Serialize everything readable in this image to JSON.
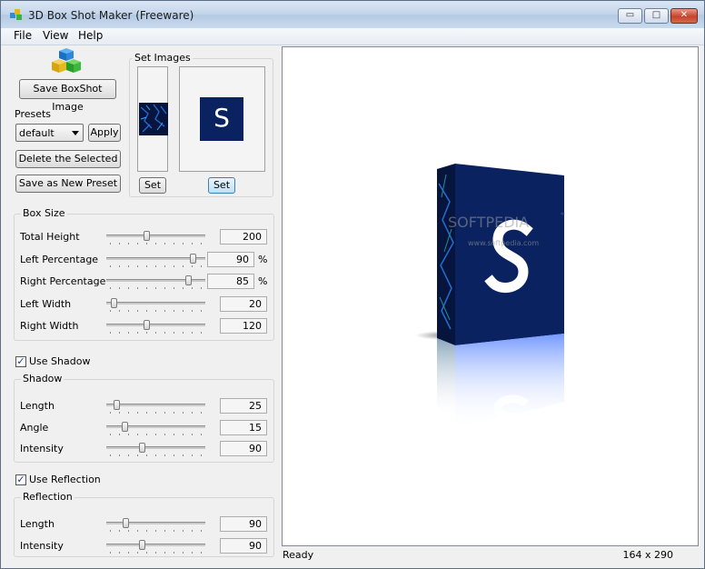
{
  "window": {
    "title": "3D Box Shot Maker (Freeware)",
    "min": "▭",
    "max": "□",
    "close": "✕"
  },
  "menu": [
    "File",
    "View",
    "Help"
  ],
  "left": {
    "save_button": "Save BoxShot Image",
    "presets_label": "Presets",
    "preset_value": "default",
    "apply_button": "Apply",
    "delete_button": "Delete the Selected",
    "save_preset_button": "Save as New Preset",
    "set_images_label": "Set Images",
    "set_side_button": "Set",
    "set_front_button": "Set",
    "front_letter": "S"
  },
  "box_size": {
    "label": "Box Size",
    "rows": [
      {
        "label": "Total Height",
        "value": "200",
        "unit": "",
        "level": 0.4
      },
      {
        "label": "Left Percentage",
        "value": "90",
        "unit": "%",
        "level": 0.9
      },
      {
        "label": "Right Percentage",
        "value": "85",
        "unit": "%",
        "level": 0.85
      },
      {
        "label": "Left Width",
        "value": "20",
        "unit": "",
        "level": 0.05
      },
      {
        "label": "Right Width",
        "value": "120",
        "unit": "",
        "level": 0.4
      }
    ]
  },
  "shadow": {
    "checkbox_label": "Use Shadow",
    "checked": true,
    "group_label": "Shadow",
    "rows": [
      {
        "label": "Length",
        "value": "25",
        "unit": "",
        "level": 0.08
      },
      {
        "label": "Angle",
        "value": "15",
        "unit": "",
        "level": 0.17
      },
      {
        "label": "Intensity",
        "value": "90",
        "unit": "",
        "level": 0.35
      }
    ]
  },
  "reflection": {
    "checkbox_label": "Use Reflection",
    "checked": true,
    "group_label": "Reflection",
    "rows": [
      {
        "label": "Length",
        "value": "90",
        "unit": "",
        "level": 0.18
      },
      {
        "label": "Intensity",
        "value": "90",
        "unit": "",
        "level": 0.35
      }
    ]
  },
  "preview": {
    "letter": "S",
    "watermark": "SOFTPEDIA",
    "watermark_tm": "™",
    "watermark_url": "www.softpedia.com"
  },
  "status": {
    "text": "Ready",
    "dimensions": "164 x 290"
  },
  "colors": {
    "box_blue": "#0a2360",
    "window_bg": "#f0f0f0"
  }
}
